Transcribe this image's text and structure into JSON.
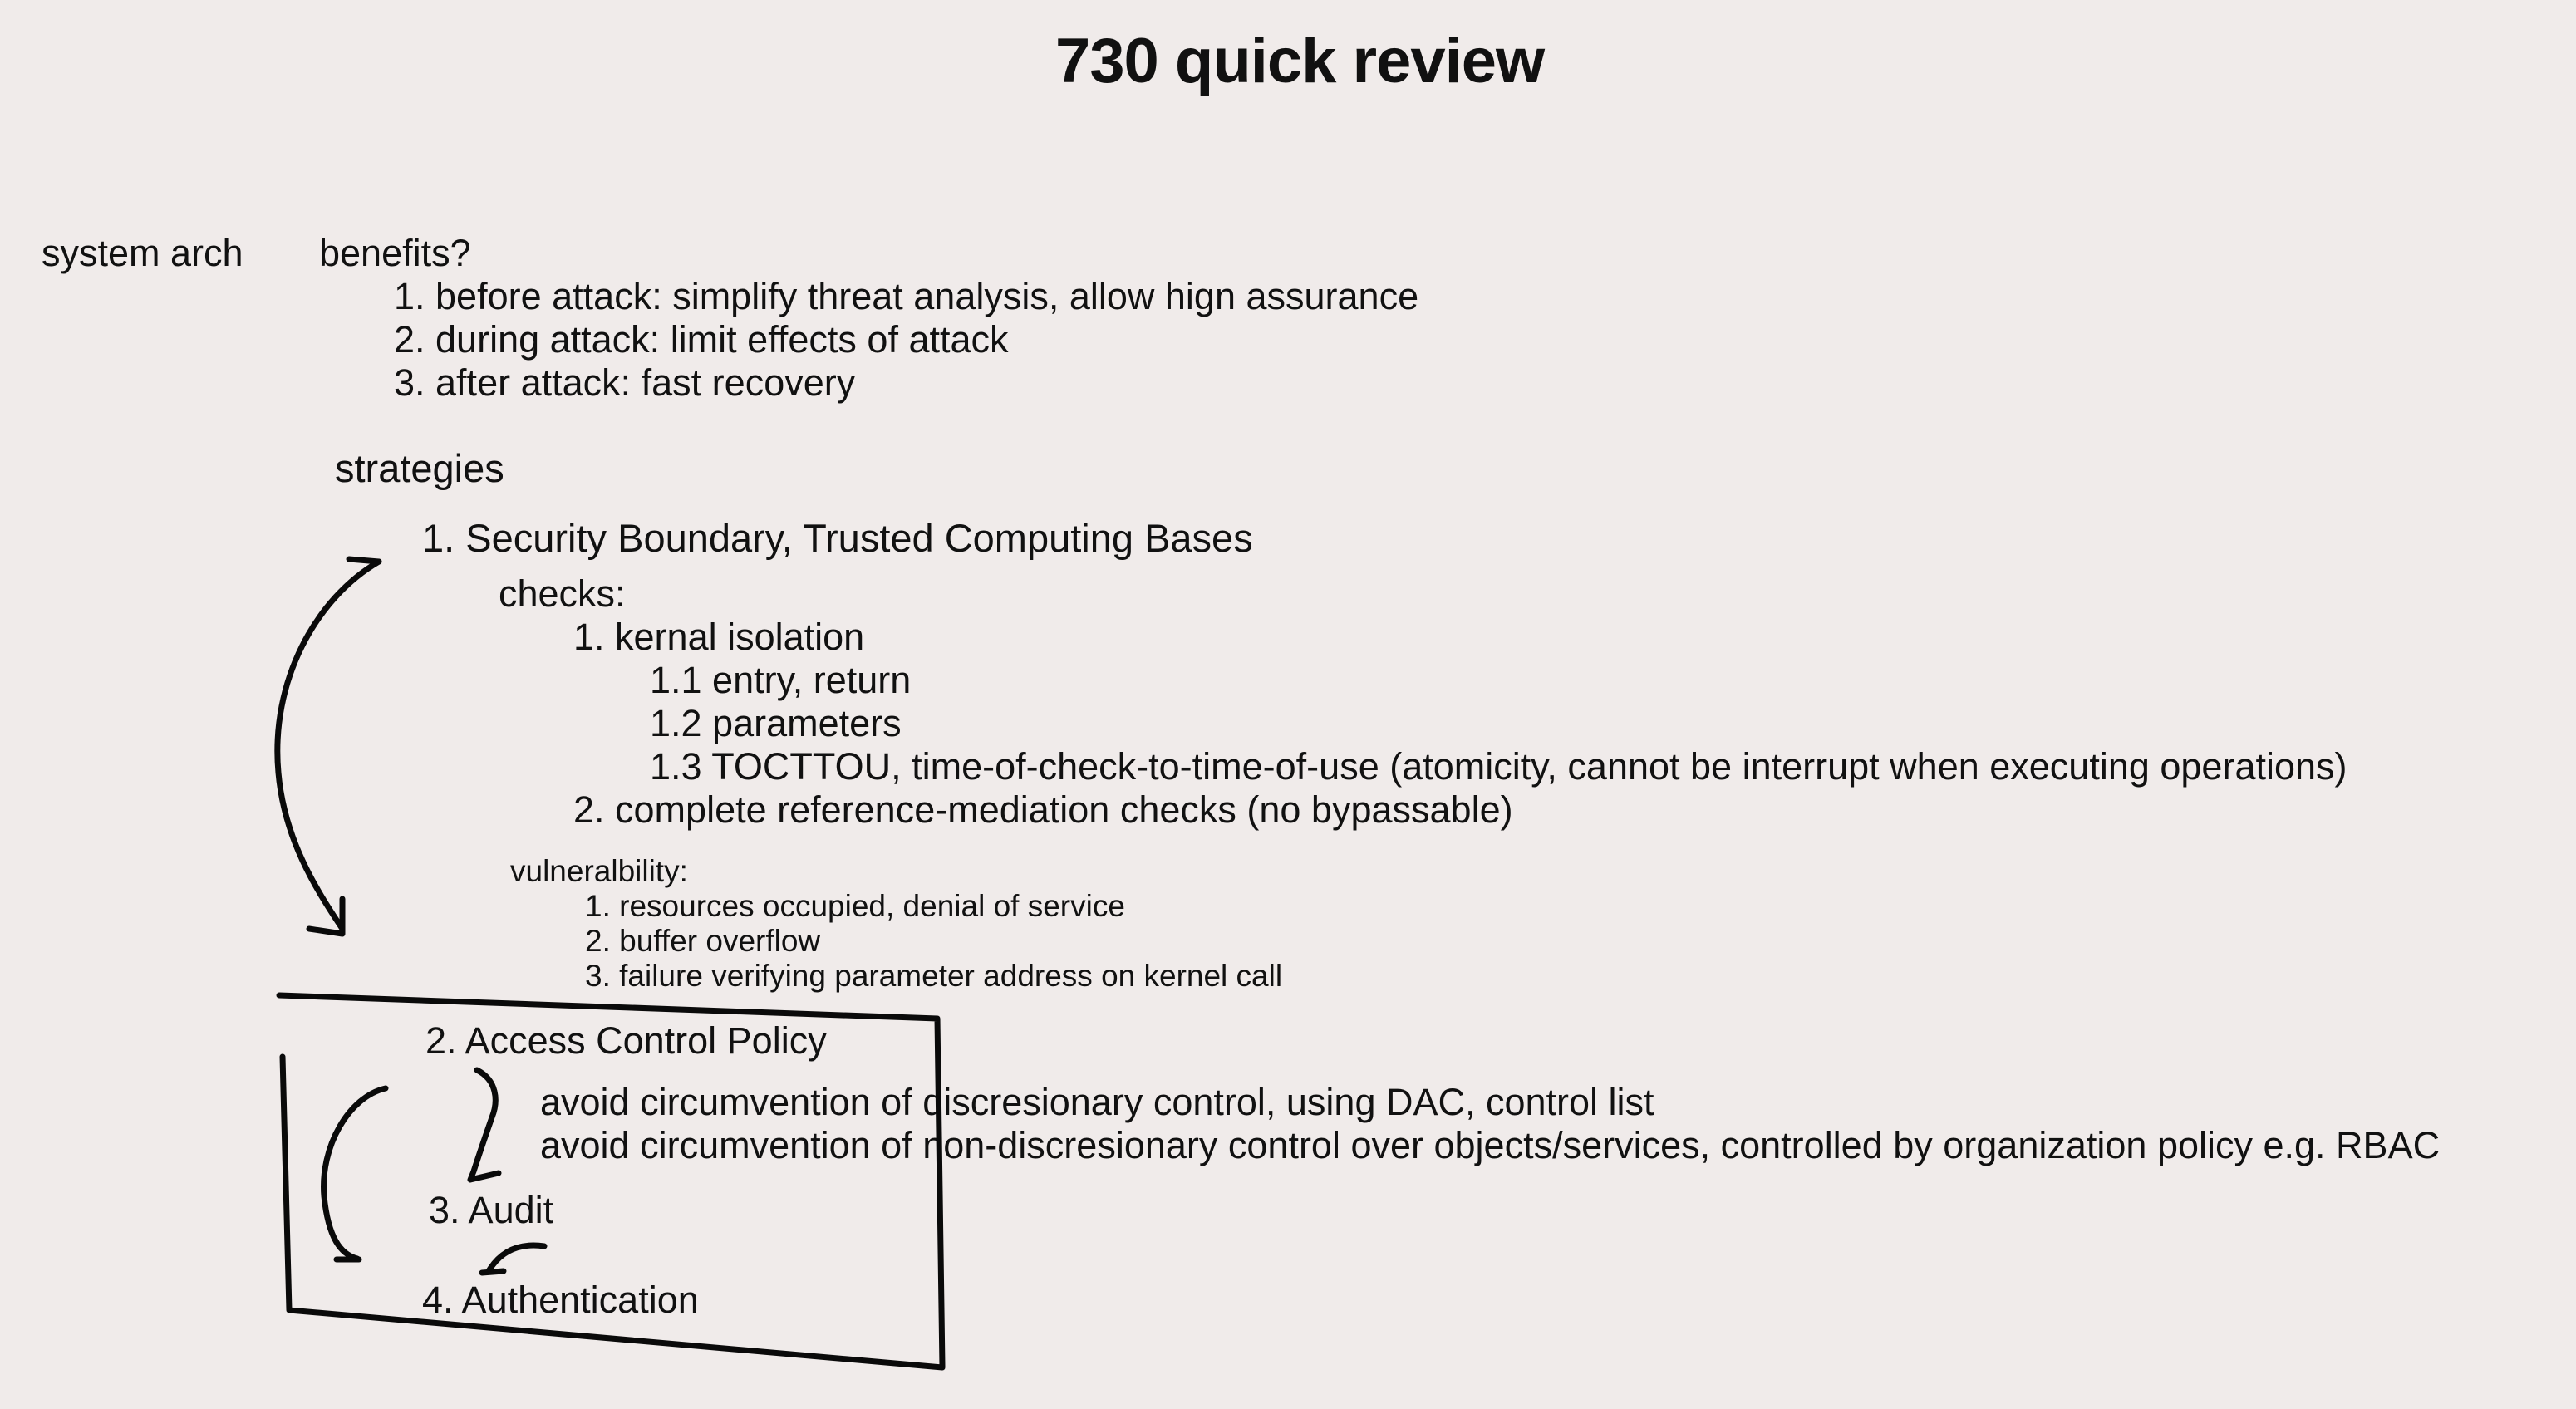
{
  "title": "730 quick review",
  "section_label": "system arch",
  "benefits": {
    "heading": "benefits?",
    "items": [
      "1. before attack: simplify threat analysis, allow hign assurance",
      "2. during attack: limit effects of attack",
      "3. after attack: fast recovery"
    ]
  },
  "strategies": {
    "heading": "strategies",
    "s1": {
      "label": "1. Security Boundary, Trusted Computing Bases",
      "checks_heading": "checks:",
      "check1": "1. kernal isolation",
      "check1_sub": [
        "1.1 entry, return",
        "1.2 parameters",
        "1.3 TOCTTOU, time-of-check-to-time-of-use (atomicity, cannot be interrupt when executing operations)"
      ],
      "check2": "2. complete reference-mediation checks (no bypassable)",
      "vuln_heading": "vulneralbility:",
      "vuln_items": [
        "1. resources occupied, denial of service",
        "2. buffer overflow",
        "3. failure verifying parameter address on kernel call"
      ]
    },
    "s2": {
      "label": "2. Access Control Policy",
      "notes": [
        "avoid circumvention of discresionary control, using DAC, control list",
        "avoid circumvention of non-discresionary control over objects/services, controlled by organization policy e.g. RBAC"
      ]
    },
    "s3": {
      "label": "3. Audit"
    },
    "s4": {
      "label": "4. Authentication"
    }
  }
}
